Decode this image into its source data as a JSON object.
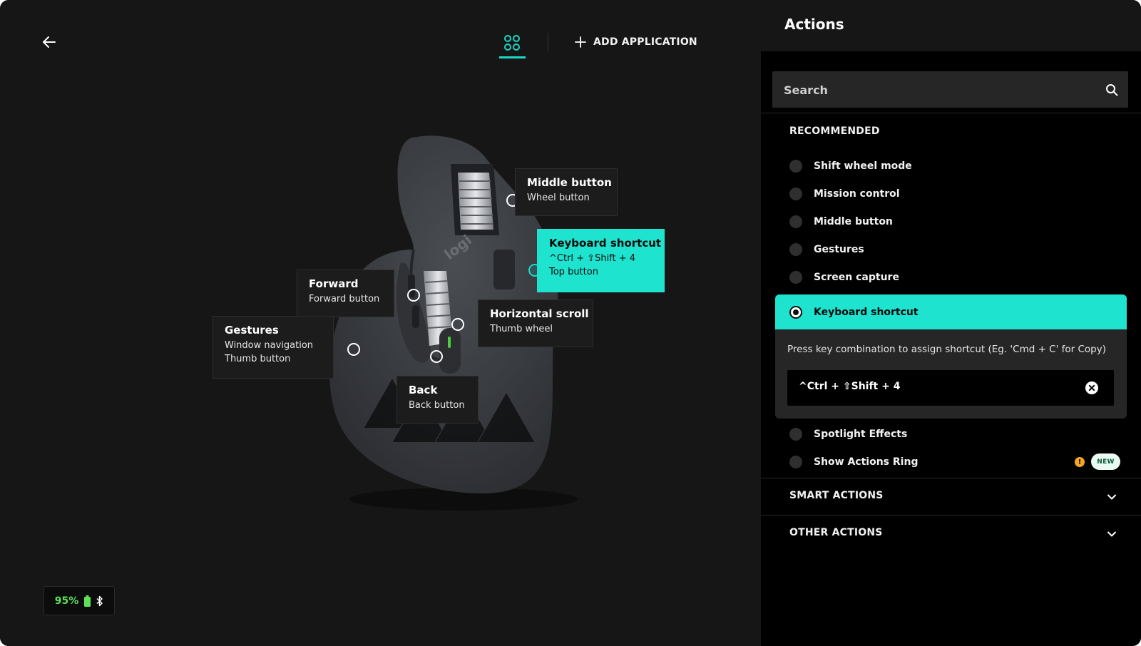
{
  "toolbar": {
    "add_application_label": "ADD APPLICATION",
    "accent_color": "#1ad9c6"
  },
  "device": {
    "brand": "logi",
    "battery_percent": "95%",
    "battery_color": "#5fe05a"
  },
  "callouts": {
    "middle": {
      "title": "Middle button",
      "subtitle": "Wheel button"
    },
    "keyboard": {
      "title": "Keyboard shortcut",
      "line1": "^Ctrl + ⇧Shift + 4",
      "subtitle": "Top button"
    },
    "forward": {
      "title": "Forward",
      "subtitle": "Forward button"
    },
    "horizontal": {
      "title": "Horizontal scroll",
      "subtitle": "Thumb wheel"
    },
    "gestures": {
      "title": "Gestures",
      "line1": "Window navigation",
      "subtitle": "Thumb button"
    },
    "back": {
      "title": "Back",
      "subtitle": "Back button"
    }
  },
  "actions_panel": {
    "title": "Actions",
    "search_placeholder": "Search",
    "recommended_title": "RECOMMENDED",
    "recommended": [
      {
        "label": "Shift wheel mode"
      },
      {
        "label": "Mission control"
      },
      {
        "label": "Middle button"
      },
      {
        "label": "Gestures"
      },
      {
        "label": "Screen capture"
      }
    ],
    "selected": {
      "label": "Keyboard shortcut",
      "hint": "Press key combination to assign shortcut (Eg. 'Cmd + C' for Copy)",
      "shortcut_value": "^Ctrl + ⇧Shift + 4"
    },
    "more": [
      {
        "label": "Spotlight Effects"
      },
      {
        "label": "Show Actions Ring",
        "badge": "NEW"
      }
    ],
    "warning_glyph": "!",
    "sections": [
      {
        "label": "SMART ACTIONS"
      },
      {
        "label": "OTHER ACTIONS"
      }
    ]
  }
}
